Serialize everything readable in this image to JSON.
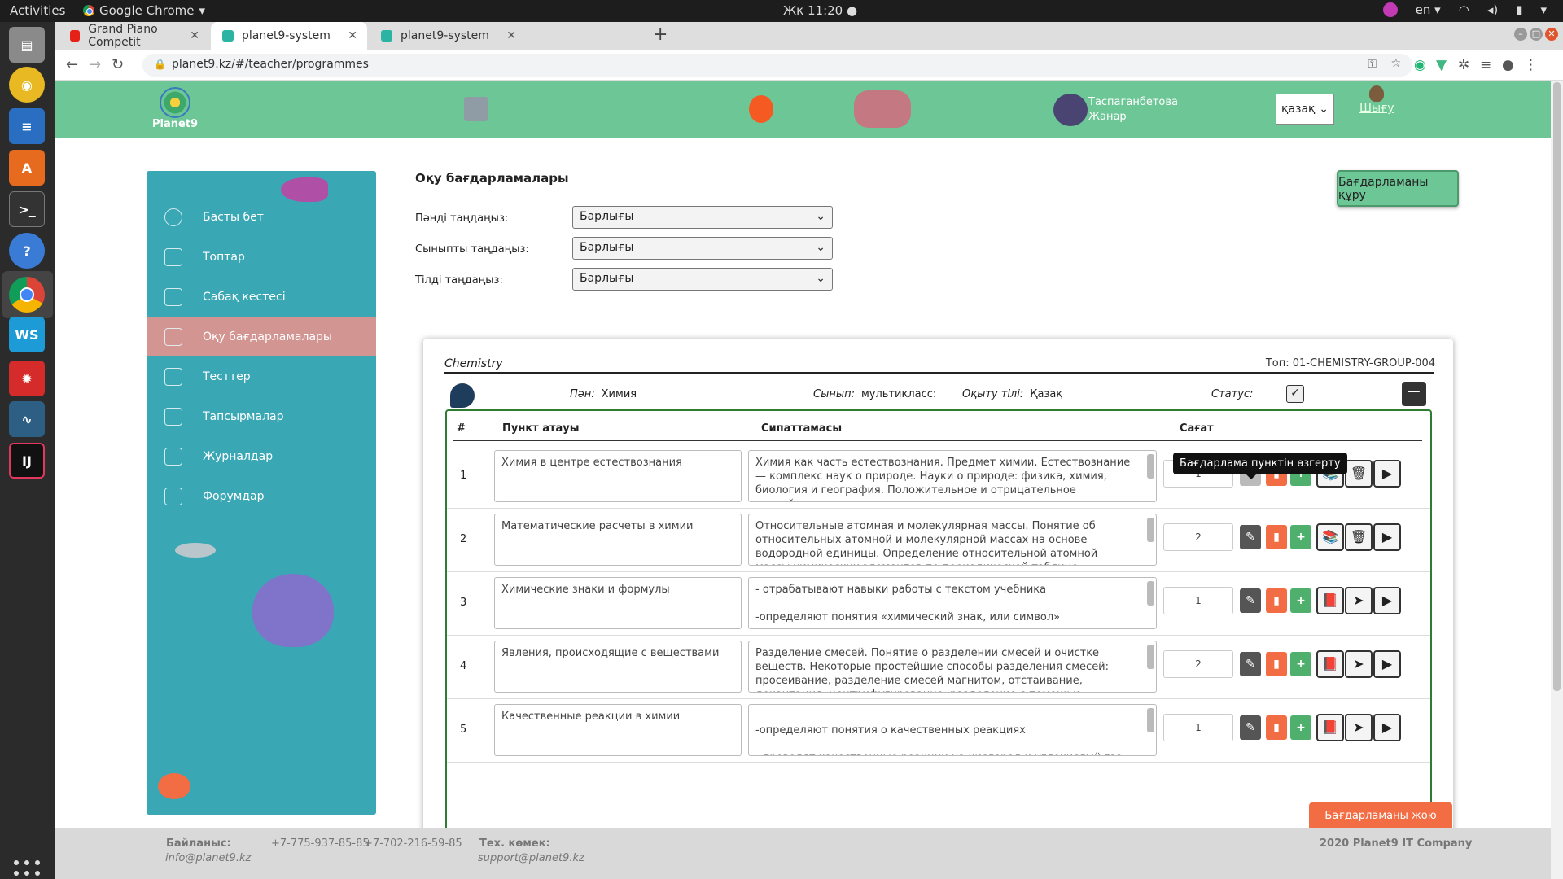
{
  "os": {
    "activities": "Activities",
    "app_name": "Google Chrome",
    "clock": "Жк 11:20 ●",
    "lang": "en"
  },
  "browser": {
    "tabs": [
      {
        "label": "Grand Piano Competit"
      },
      {
        "label": "planet9-system"
      },
      {
        "label": "planet9-system"
      }
    ],
    "url": "planet9.kz/#/teacher/programmes"
  },
  "header": {
    "logo_text": "Planet9",
    "user_name_1": "Таспаганбетова",
    "user_name_2": "Жанар",
    "language": "қазақ",
    "logout": "Шығу"
  },
  "sidebar": {
    "items": [
      {
        "label": "Басты бет"
      },
      {
        "label": "Топтар"
      },
      {
        "label": "Сабақ кестесі"
      },
      {
        "label": "Оқу бағдарламалары"
      },
      {
        "label": "Тесттер"
      },
      {
        "label": "Тапсырмалар"
      },
      {
        "label": "Журналдар"
      },
      {
        "label": "Форумдар"
      }
    ]
  },
  "main": {
    "title": "Оқу бағдарламалары",
    "create_button": "Бағдарламаны құру",
    "filters": [
      {
        "label": "Пәнді таңдаңыз:",
        "value": "Барлығы"
      },
      {
        "label": "Сыныпты таңдаңыз:",
        "value": "Барлығы"
      },
      {
        "label": "Тілді таңдаңыз:",
        "value": "Барлығы"
      }
    ]
  },
  "program": {
    "title": "Chemistry",
    "group": "Топ: 01-CHEMISTRY-GROUP-004",
    "subject_label": "Пән:",
    "subject": "Химия",
    "class_label": "Сынып:",
    "class": "мультикласс:",
    "lang_label": "Оқыту тілі:",
    "lang": "Қазақ",
    "status_label": "Статус:",
    "columns": {
      "num": "#",
      "name": "Пункт атауы",
      "desc": "Сипаттамасы",
      "hours": "Сағат"
    },
    "rows": [
      {
        "num": "1",
        "name": "Химия в центре естествознания",
        "desc": "Химия как часть естествознания. Предмет химии. Естествознание — комплекс наук о природе. Науки о природе: физика, химия, биология и география. Положительное и отрицательное воздействие человека на природу",
        "hours": "1"
      },
      {
        "num": "2",
        "name": "Математические расчеты в химии",
        "desc": "Относительные атомная и молекулярная массы. Понятие об относительных атомной и молекулярной массах на основе водородной единицы. Определение относительной атомной массы химических элементов по периодической таблице",
        "hours": "2"
      },
      {
        "num": "3",
        "name": "Химические знаки и формулы",
        "desc": "- отрабатывают навыки работы с текстом учебника\n\n-определяют понятия «химический знак, или символ»",
        "hours": "1"
      },
      {
        "num": "4",
        "name": "Явления, происходящие с веществами",
        "desc": "Разделение смесей. Понятие о разделении смесей и очистке веществ. Некоторые простейшие способы разделения смесей: просеивание, разделение смесей магнитом, отстаивание, декантация, центрифугирование, разделение с помощью делительной воронки",
        "hours": "2"
      },
      {
        "num": "5",
        "name": "Качественные реакции в химии",
        "desc": "\n-определяют понятия о качественных реакциях\n\n- проводят качественные реакции на кислород и углекислый газ",
        "hours": "1"
      }
    ],
    "tooltip": "Бағдарлама пунктін өзгерту",
    "delete_button": "Бағдарламаны жою"
  },
  "footer": {
    "contact_label": "Байланыс:",
    "contact_email": "info@planet9.kz",
    "phone1": "+7-775-937-85-85",
    "phone2": "+7-702-216-59-85",
    "support_label": "Тех. көмек:",
    "support_email": "support@planet9.kz",
    "copyright": "2020 Planet9 IT Company"
  }
}
